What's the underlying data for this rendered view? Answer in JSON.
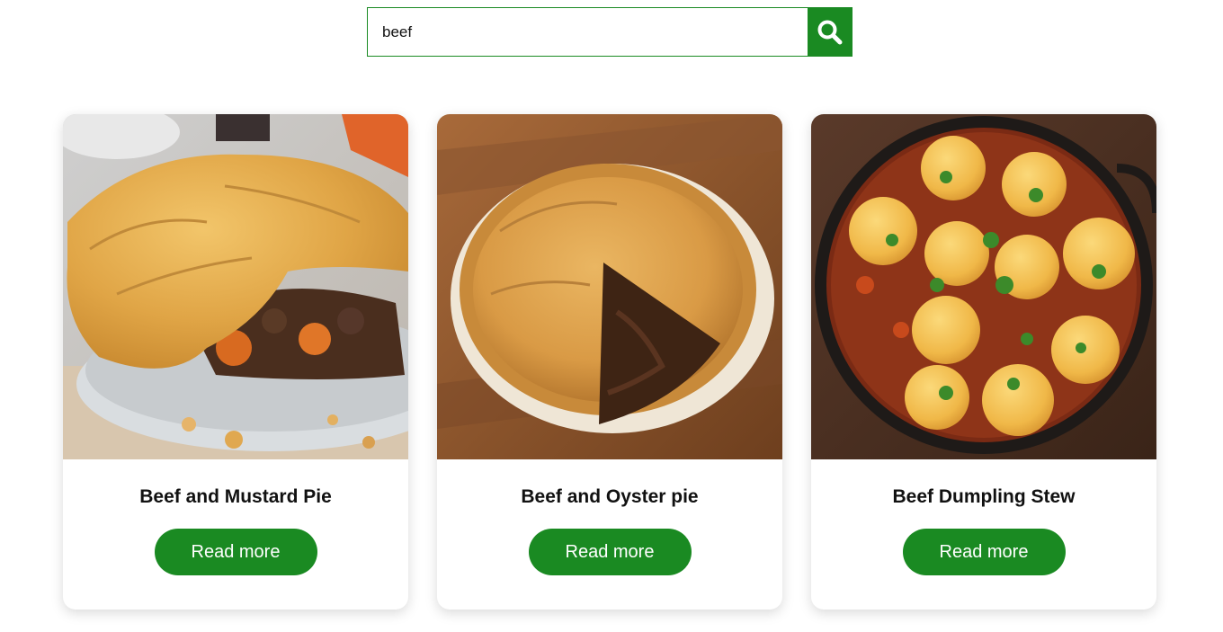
{
  "search": {
    "value": "beef",
    "placeholder": ""
  },
  "accent_color": "#1a8a22",
  "recipes": [
    {
      "title": "Beef and Mustard Pie",
      "button_label": "Read more"
    },
    {
      "title": "Beef and Oyster pie",
      "button_label": "Read more"
    },
    {
      "title": "Beef Dumpling Stew",
      "button_label": "Read more"
    }
  ]
}
